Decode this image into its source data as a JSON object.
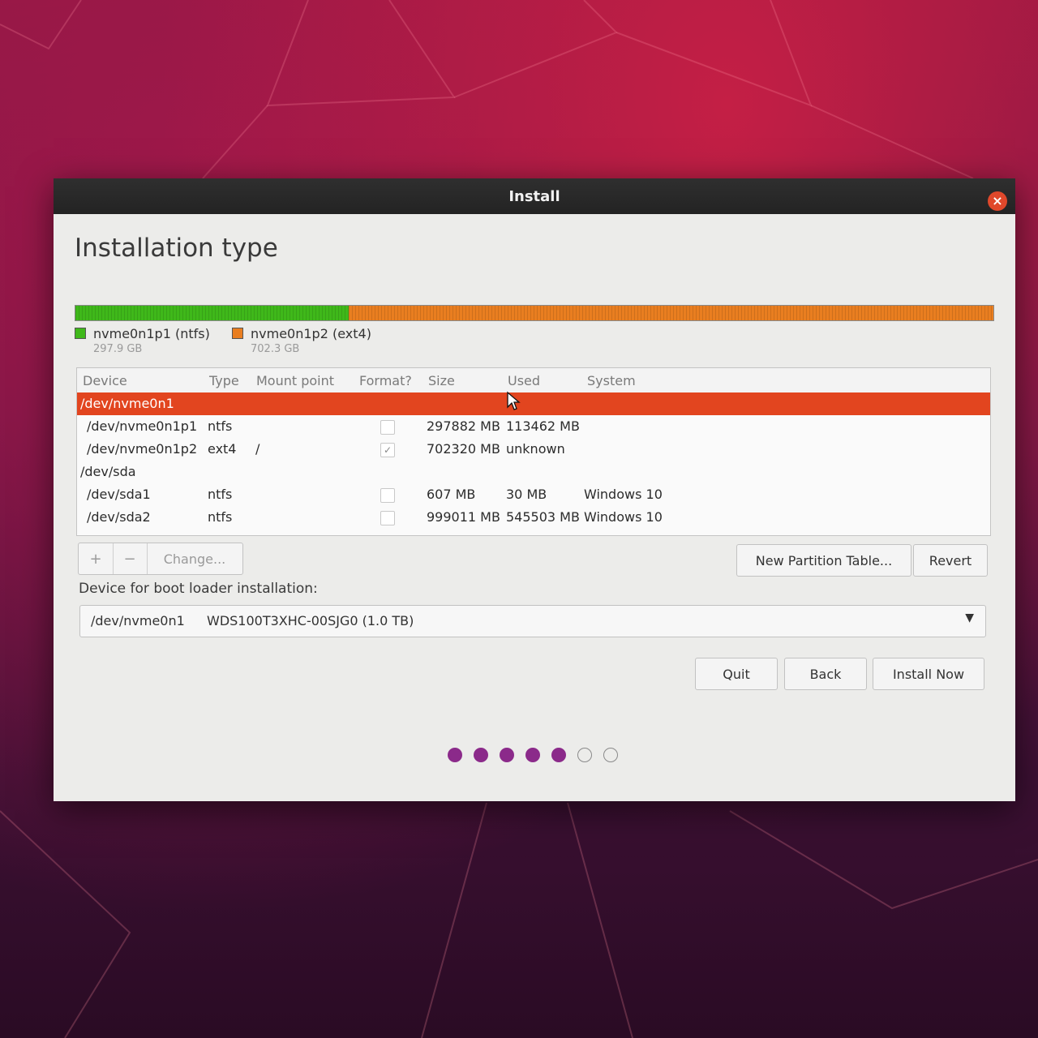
{
  "window": {
    "title": "Install",
    "close_label": "×"
  },
  "page": {
    "title": "Installation type"
  },
  "usage_bar": {
    "segments": [
      {
        "name": "nvme0n1p1 (ntfs)",
        "size": "297.9 GB",
        "color": "#3fb81a",
        "fraction": 0.298
      },
      {
        "name": "nvme0n1p2 (ext4)",
        "size": "702.3 GB",
        "color": "#e97e20",
        "fraction": 0.702
      }
    ]
  },
  "table": {
    "headers": {
      "device": "Device",
      "type": "Type",
      "mount": "Mount point",
      "format": "Format?",
      "size": "Size",
      "used": "Used",
      "system": "System"
    },
    "rows": [
      {
        "device": "/dev/nvme0n1",
        "type": "",
        "mount": "",
        "size": "",
        "used": "",
        "system": ""
      },
      {
        "device": "/dev/nvme0n1p1",
        "type": "ntfs",
        "mount": "",
        "format": "",
        "size": "297882 MB",
        "used": "113462 MB",
        "system": ""
      },
      {
        "device": "/dev/nvme0n1p2",
        "type": "ext4",
        "mount": "/",
        "format": "✓",
        "size": "702320 MB",
        "used": "unknown",
        "system": ""
      },
      {
        "device": "/dev/sda",
        "type": "",
        "mount": "",
        "size": "",
        "used": "",
        "system": ""
      },
      {
        "device": "/dev/sda1",
        "type": "ntfs",
        "mount": "",
        "format": "",
        "size": "607 MB",
        "used": "30 MB",
        "system": "Windows 10"
      },
      {
        "device": "/dev/sda2",
        "type": "ntfs",
        "mount": "",
        "format": "",
        "size": "999011 MB",
        "used": "545503 MB",
        "system": "Windows 10"
      }
    ]
  },
  "partition_tools": {
    "add": "+",
    "remove": "−",
    "change": "Change..."
  },
  "table_buttons": {
    "new_table": "New Partition Table...",
    "revert": "Revert"
  },
  "bootloader": {
    "label": "Device for boot loader installation:",
    "device": "/dev/nvme0n1",
    "description": "WDS100T3XHC-00SJG0 (1.0 TB)",
    "arrow": "▼"
  },
  "actions": {
    "quit": "Quit",
    "back": "Back",
    "install": "Install Now"
  },
  "progress": {
    "steps_total": 7,
    "steps_done": 5
  },
  "colors": {
    "selection": "#e2451f",
    "accent_dots": "#8b2a8a",
    "close": "#e0482b"
  }
}
